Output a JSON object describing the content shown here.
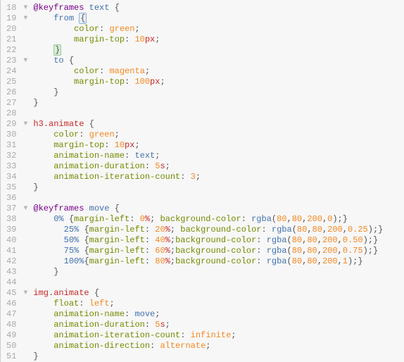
{
  "lines": [
    {
      "num": 18,
      "fold": true,
      "indent": 0,
      "tokens": [
        [
          "@keyframes",
          "t-def"
        ],
        [
          " ",
          ""
        ],
        [
          "text",
          "t-sel"
        ],
        [
          " ",
          ""
        ],
        [
          "{",
          "t-punc"
        ]
      ]
    },
    {
      "num": 19,
      "fold": true,
      "indent": 4,
      "tokens": [
        [
          "from",
          "t-sel"
        ],
        [
          " ",
          ""
        ],
        [
          "{",
          "cursor-brace"
        ]
      ]
    },
    {
      "num": 20,
      "fold": false,
      "indent": 8,
      "tokens": [
        [
          "color",
          "t-prop"
        ],
        [
          ":",
          "t-punc"
        ],
        [
          " ",
          ""
        ],
        [
          "green",
          "t-val"
        ],
        [
          ";",
          "t-punc"
        ]
      ]
    },
    {
      "num": 21,
      "fold": false,
      "indent": 8,
      "tokens": [
        [
          "margin-top",
          "t-prop"
        ],
        [
          ":",
          "t-punc"
        ],
        [
          " ",
          ""
        ],
        [
          "10",
          "t-num"
        ],
        [
          "px",
          "t-unit"
        ],
        [
          ";",
          "t-punc"
        ]
      ]
    },
    {
      "num": 22,
      "fold": false,
      "indent": 4,
      "tokens": [
        [
          "}",
          "match-brace"
        ]
      ]
    },
    {
      "num": 23,
      "fold": true,
      "indent": 4,
      "tokens": [
        [
          "to",
          "t-sel"
        ],
        [
          " ",
          ""
        ],
        [
          "{",
          "t-punc"
        ]
      ]
    },
    {
      "num": 24,
      "fold": false,
      "indent": 8,
      "tokens": [
        [
          "color",
          "t-prop"
        ],
        [
          ":",
          "t-punc"
        ],
        [
          " ",
          ""
        ],
        [
          "magenta",
          "t-val"
        ],
        [
          ";",
          "t-punc"
        ]
      ]
    },
    {
      "num": 25,
      "fold": false,
      "indent": 8,
      "tokens": [
        [
          "margin-top",
          "t-prop"
        ],
        [
          ":",
          "t-punc"
        ],
        [
          " ",
          ""
        ],
        [
          "100",
          "t-num"
        ],
        [
          "px",
          "t-unit"
        ],
        [
          ";",
          "t-punc"
        ]
      ]
    },
    {
      "num": 26,
      "fold": false,
      "indent": 4,
      "tokens": [
        [
          "}",
          "t-punc"
        ]
      ]
    },
    {
      "num": 27,
      "fold": false,
      "indent": 0,
      "tokens": [
        [
          "}",
          "t-punc"
        ]
      ]
    },
    {
      "num": 28,
      "fold": false,
      "indent": 0,
      "tokens": []
    },
    {
      "num": 29,
      "fold": true,
      "indent": 0,
      "tokens": [
        [
          "h3",
          "t-tag"
        ],
        [
          ".animate",
          "t-qual"
        ],
        [
          " ",
          ""
        ],
        [
          "{",
          "t-punc"
        ]
      ]
    },
    {
      "num": 30,
      "fold": false,
      "indent": 4,
      "tokens": [
        [
          "color",
          "t-prop"
        ],
        [
          ":",
          "t-punc"
        ],
        [
          " ",
          ""
        ],
        [
          "green",
          "t-val"
        ],
        [
          ";",
          "t-punc"
        ]
      ]
    },
    {
      "num": 31,
      "fold": false,
      "indent": 4,
      "tokens": [
        [
          "margin-top",
          "t-prop"
        ],
        [
          ":",
          "t-punc"
        ],
        [
          " ",
          ""
        ],
        [
          "10",
          "t-num"
        ],
        [
          "px",
          "t-unit"
        ],
        [
          ";",
          "t-punc"
        ]
      ]
    },
    {
      "num": 32,
      "fold": false,
      "indent": 4,
      "tokens": [
        [
          "animation-name",
          "t-prop"
        ],
        [
          ":",
          "t-punc"
        ],
        [
          " ",
          ""
        ],
        [
          "text",
          "t-sel"
        ],
        [
          ";",
          "t-punc"
        ]
      ]
    },
    {
      "num": 33,
      "fold": false,
      "indent": 4,
      "tokens": [
        [
          "animation-duration",
          "t-prop"
        ],
        [
          ":",
          "t-punc"
        ],
        [
          " ",
          ""
        ],
        [
          "5",
          "t-num"
        ],
        [
          "s",
          "t-unit"
        ],
        [
          ";",
          "t-punc"
        ]
      ]
    },
    {
      "num": 34,
      "fold": false,
      "indent": 4,
      "tokens": [
        [
          "animation-iteration-count",
          "t-prop"
        ],
        [
          ":",
          "t-punc"
        ],
        [
          " ",
          ""
        ],
        [
          "3",
          "t-num"
        ],
        [
          ";",
          "t-punc"
        ]
      ]
    },
    {
      "num": 35,
      "fold": false,
      "indent": 0,
      "tokens": [
        [
          "}",
          "t-punc"
        ]
      ]
    },
    {
      "num": 36,
      "fold": false,
      "indent": 0,
      "tokens": []
    },
    {
      "num": 37,
      "fold": true,
      "indent": 0,
      "tokens": [
        [
          "@keyframes",
          "t-def"
        ],
        [
          " ",
          ""
        ],
        [
          "move",
          "t-sel"
        ],
        [
          " ",
          ""
        ],
        [
          "{",
          "t-punc"
        ]
      ]
    },
    {
      "num": 38,
      "fold": false,
      "indent": 4,
      "tokens": [
        [
          "0%",
          "t-sel"
        ],
        [
          " ",
          ""
        ],
        [
          "{",
          "t-punc"
        ],
        [
          "margin-left",
          "t-prop"
        ],
        [
          ":",
          "t-punc"
        ],
        [
          " ",
          ""
        ],
        [
          "0",
          "t-num"
        ],
        [
          "%",
          "t-unit"
        ],
        [
          ";",
          "t-punc"
        ],
        [
          " ",
          ""
        ],
        [
          "background-color",
          "t-prop"
        ],
        [
          ":",
          "t-punc"
        ],
        [
          " ",
          ""
        ],
        [
          "rgba",
          "t-func"
        ],
        [
          "(",
          "t-punc"
        ],
        [
          "80",
          "t-num"
        ],
        [
          ",",
          "t-punc"
        ],
        [
          "80",
          "t-num"
        ],
        [
          ",",
          "t-punc"
        ],
        [
          "200",
          "t-num"
        ],
        [
          ",",
          "t-punc"
        ],
        [
          "0",
          "t-num"
        ],
        [
          ")",
          "t-punc"
        ],
        [
          ";",
          "t-punc"
        ],
        [
          "}",
          "t-punc"
        ]
      ]
    },
    {
      "num": 39,
      "fold": false,
      "indent": 6,
      "tokens": [
        [
          "25%",
          "t-sel"
        ],
        [
          " ",
          ""
        ],
        [
          "{",
          "t-punc"
        ],
        [
          "margin-left",
          "t-prop"
        ],
        [
          ":",
          "t-punc"
        ],
        [
          " ",
          ""
        ],
        [
          "20",
          "t-num"
        ],
        [
          "%",
          "t-unit"
        ],
        [
          ";",
          "t-punc"
        ],
        [
          " ",
          ""
        ],
        [
          "background-color",
          "t-prop"
        ],
        [
          ":",
          "t-punc"
        ],
        [
          " ",
          ""
        ],
        [
          "rgba",
          "t-func"
        ],
        [
          "(",
          "t-punc"
        ],
        [
          "80",
          "t-num"
        ],
        [
          ",",
          "t-punc"
        ],
        [
          "80",
          "t-num"
        ],
        [
          ",",
          "t-punc"
        ],
        [
          "200",
          "t-num"
        ],
        [
          ",",
          "t-punc"
        ],
        [
          "0.25",
          "t-num"
        ],
        [
          ")",
          "t-punc"
        ],
        [
          ";",
          "t-punc"
        ],
        [
          "}",
          "t-punc"
        ]
      ]
    },
    {
      "num": 40,
      "fold": false,
      "indent": 6,
      "tokens": [
        [
          "50%",
          "t-sel"
        ],
        [
          " ",
          ""
        ],
        [
          "{",
          "t-punc"
        ],
        [
          "margin-left",
          "t-prop"
        ],
        [
          ":",
          "t-punc"
        ],
        [
          " ",
          ""
        ],
        [
          "40",
          "t-num"
        ],
        [
          "%",
          "t-unit"
        ],
        [
          ";",
          "t-punc"
        ],
        [
          "background-color",
          "t-prop"
        ],
        [
          ":",
          "t-punc"
        ],
        [
          " ",
          ""
        ],
        [
          "rgba",
          "t-func"
        ],
        [
          "(",
          "t-punc"
        ],
        [
          "80",
          "t-num"
        ],
        [
          ",",
          "t-punc"
        ],
        [
          "80",
          "t-num"
        ],
        [
          ",",
          "t-punc"
        ],
        [
          "200",
          "t-num"
        ],
        [
          ",",
          "t-punc"
        ],
        [
          "0.50",
          "t-num"
        ],
        [
          ")",
          "t-punc"
        ],
        [
          ";",
          "t-punc"
        ],
        [
          "}",
          "t-punc"
        ]
      ]
    },
    {
      "num": 41,
      "fold": false,
      "indent": 6,
      "tokens": [
        [
          "75%",
          "t-sel"
        ],
        [
          " ",
          ""
        ],
        [
          "{",
          "t-punc"
        ],
        [
          "margin-left",
          "t-prop"
        ],
        [
          ":",
          "t-punc"
        ],
        [
          " ",
          ""
        ],
        [
          "60",
          "t-num"
        ],
        [
          "%",
          "t-unit"
        ],
        [
          ";",
          "t-punc"
        ],
        [
          "background-color",
          "t-prop"
        ],
        [
          ":",
          "t-punc"
        ],
        [
          " ",
          ""
        ],
        [
          "rgba",
          "t-func"
        ],
        [
          "(",
          "t-punc"
        ],
        [
          "80",
          "t-num"
        ],
        [
          ",",
          "t-punc"
        ],
        [
          "80",
          "t-num"
        ],
        [
          ",",
          "t-punc"
        ],
        [
          "200",
          "t-num"
        ],
        [
          ",",
          "t-punc"
        ],
        [
          "0.75",
          "t-num"
        ],
        [
          ")",
          "t-punc"
        ],
        [
          ";",
          "t-punc"
        ],
        [
          "}",
          "t-punc"
        ]
      ]
    },
    {
      "num": 42,
      "fold": false,
      "indent": 6,
      "tokens": [
        [
          "100%",
          "t-sel"
        ],
        [
          "{",
          "t-punc"
        ],
        [
          "margin-left",
          "t-prop"
        ],
        [
          ":",
          "t-punc"
        ],
        [
          " ",
          ""
        ],
        [
          "80",
          "t-num"
        ],
        [
          "%",
          "t-unit"
        ],
        [
          ";",
          "t-punc"
        ],
        [
          "background-color",
          "t-prop"
        ],
        [
          ":",
          "t-punc"
        ],
        [
          " ",
          ""
        ],
        [
          "rgba",
          "t-func"
        ],
        [
          "(",
          "t-punc"
        ],
        [
          "80",
          "t-num"
        ],
        [
          ",",
          "t-punc"
        ],
        [
          "80",
          "t-num"
        ],
        [
          ",",
          "t-punc"
        ],
        [
          "200",
          "t-num"
        ],
        [
          ",",
          "t-punc"
        ],
        [
          "1",
          "t-num"
        ],
        [
          ")",
          "t-punc"
        ],
        [
          ";",
          "t-punc"
        ],
        [
          "}",
          "t-punc"
        ]
      ]
    },
    {
      "num": 43,
      "fold": false,
      "indent": 4,
      "tokens": [
        [
          "}",
          "t-punc"
        ]
      ]
    },
    {
      "num": 44,
      "fold": false,
      "indent": 0,
      "tokens": []
    },
    {
      "num": 45,
      "fold": true,
      "indent": 0,
      "tokens": [
        [
          "img",
          "t-tag"
        ],
        [
          ".animate",
          "t-qual"
        ],
        [
          " ",
          ""
        ],
        [
          "{",
          "t-punc"
        ]
      ]
    },
    {
      "num": 46,
      "fold": false,
      "indent": 4,
      "tokens": [
        [
          "float",
          "t-prop"
        ],
        [
          ":",
          "t-punc"
        ],
        [
          " ",
          ""
        ],
        [
          "left",
          "t-val"
        ],
        [
          ";",
          "t-punc"
        ]
      ]
    },
    {
      "num": 47,
      "fold": false,
      "indent": 4,
      "tokens": [
        [
          "animation-name",
          "t-prop"
        ],
        [
          ":",
          "t-punc"
        ],
        [
          " ",
          ""
        ],
        [
          "move",
          "t-sel"
        ],
        [
          ";",
          "t-punc"
        ]
      ]
    },
    {
      "num": 48,
      "fold": false,
      "indent": 4,
      "tokens": [
        [
          "animation-duration",
          "t-prop"
        ],
        [
          ":",
          "t-punc"
        ],
        [
          " ",
          ""
        ],
        [
          "5",
          "t-num"
        ],
        [
          "s",
          "t-unit"
        ],
        [
          ";",
          "t-punc"
        ]
      ]
    },
    {
      "num": 49,
      "fold": false,
      "indent": 4,
      "tokens": [
        [
          "animation-iteration-count",
          "t-prop"
        ],
        [
          ":",
          "t-punc"
        ],
        [
          " ",
          ""
        ],
        [
          "infinite",
          "t-val"
        ],
        [
          ";",
          "t-punc"
        ]
      ]
    },
    {
      "num": 50,
      "fold": false,
      "indent": 4,
      "tokens": [
        [
          "animation-direction",
          "t-prop"
        ],
        [
          ":",
          "t-punc"
        ],
        [
          " ",
          ""
        ],
        [
          "alternate",
          "t-val"
        ],
        [
          ";",
          "t-punc"
        ]
      ]
    },
    {
      "num": 51,
      "fold": false,
      "indent": 0,
      "tokens": [
        [
          "}",
          "t-punc"
        ]
      ]
    }
  ]
}
